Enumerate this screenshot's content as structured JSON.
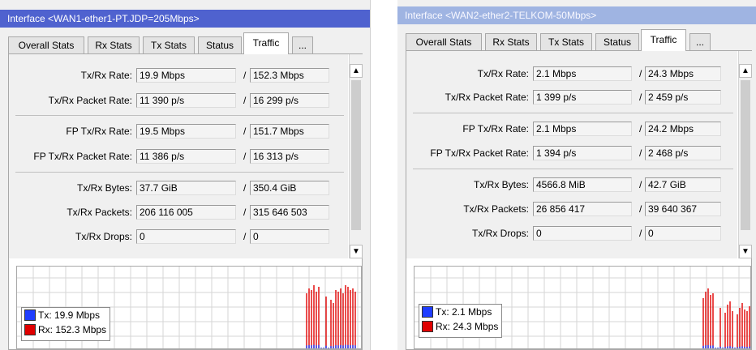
{
  "windows": [
    {
      "title": "Interface <WAN1-ether1-PT.JDP=205Mbps>",
      "tabs": [
        "Overall Stats",
        "Rx Stats",
        "Tx Stats",
        "Status",
        "Traffic",
        "..."
      ],
      "active_tab": "Traffic",
      "stats": {
        "tx_rx_rate": {
          "label": "Tx/Rx Rate:",
          "tx": "19.9 Mbps",
          "rx": "152.3 Mbps"
        },
        "tx_rx_packet_rate": {
          "label": "Tx/Rx Packet Rate:",
          "tx": "11 390 p/s",
          "rx": "16 299 p/s"
        },
        "fp_tx_rx_rate": {
          "label": "FP Tx/Rx Rate:",
          "tx": "19.5 Mbps",
          "rx": "151.7 Mbps"
        },
        "fp_tx_rx_packet_rate": {
          "label": "FP Tx/Rx Packet Rate:",
          "tx": "11 386 p/s",
          "rx": "16 313 p/s"
        },
        "tx_rx_bytes": {
          "label": "Tx/Rx Bytes:",
          "tx": "37.7 GiB",
          "rx": "350.4 GiB"
        },
        "tx_rx_packets": {
          "label": "Tx/Rx Packets:",
          "tx": "206 116 005",
          "rx": "315 646 503"
        },
        "tx_rx_drops": {
          "label": "Tx/Rx Drops:",
          "tx": "0",
          "rx": "0"
        }
      },
      "separator": "/",
      "scroll_up_glyph": "▲",
      "scroll_down_glyph": "▼",
      "legend": {
        "tx": "Tx:  19.9 Mbps",
        "rx": "Rx:  152.3 Mbps"
      }
    },
    {
      "title": "Interface <WAN2-ether2-TELKOM-50Mbps>",
      "tabs": [
        "Overall Stats",
        "Rx Stats",
        "Tx Stats",
        "Status",
        "Traffic",
        "..."
      ],
      "active_tab": "Traffic",
      "stats": {
        "tx_rx_rate": {
          "label": "Tx/Rx Rate:",
          "tx": "2.1 Mbps",
          "rx": "24.3 Mbps"
        },
        "tx_rx_packet_rate": {
          "label": "Tx/Rx Packet Rate:",
          "tx": "1 399 p/s",
          "rx": "2 459 p/s"
        },
        "fp_tx_rx_rate": {
          "label": "FP Tx/Rx Rate:",
          "tx": "2.1 Mbps",
          "rx": "24.2 Mbps"
        },
        "fp_tx_rx_packet_rate": {
          "label": "FP Tx/Rx Packet Rate:",
          "tx": "1 394 p/s",
          "rx": "2 468 p/s"
        },
        "tx_rx_bytes": {
          "label": "Tx/Rx Bytes:",
          "tx": "4566.8 MiB",
          "rx": "42.7 GiB"
        },
        "tx_rx_packets": {
          "label": "Tx/Rx Packets:",
          "tx": "26 856 417",
          "rx": "39 640 367"
        },
        "tx_rx_drops": {
          "label": "Tx/Rx Drops:",
          "tx": "0",
          "rx": "0"
        }
      },
      "separator": "/",
      "scroll_up_glyph": "▲",
      "scroll_down_glyph": "▼",
      "legend": {
        "tx": "Tx:  2.1 Mbps",
        "rx": "Rx:  24.3 Mbps"
      }
    }
  ],
  "colors": {
    "active_title": "#4f62cf",
    "inactive_title": "#9fb4e2",
    "tx_series": "#1f3dff",
    "rx_series": "#e00000",
    "graph_grid": "#d6d6d6"
  }
}
